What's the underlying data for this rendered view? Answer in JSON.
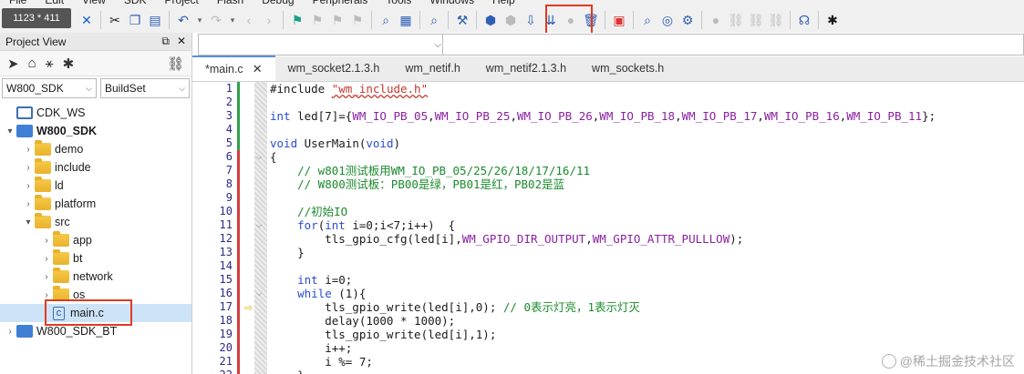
{
  "menu": [
    "File",
    "Edit",
    "View",
    "SDK",
    "Project",
    "Flash",
    "Debug",
    "Peripherals",
    "Tools",
    "Windows",
    "Help"
  ],
  "dim_badge": "1123 * 411",
  "toolbar_icons": [
    "new-icon",
    "open-icon",
    "save-icon",
    "close-icon",
    "cut-icon",
    "copy-icon",
    "paste-icon",
    "undo-icon",
    "redo-icon",
    "back-icon",
    "forward-icon",
    "bookmark-icon",
    "bookmark-prev-icon",
    "bookmark-next-icon",
    "bookmark-clear-icon",
    "find-icon",
    "find-in-files-icon",
    "find-replace-icon",
    "build-icon",
    "rebuild-icon",
    "download-icon",
    "erase-icon",
    "delete-icon",
    "load-icon",
    "debug-icon",
    "debug-start-icon",
    "settings-icon",
    "breakpoint-icon",
    "link-icon",
    "unlink-icon",
    "unlink2-icon",
    "help-icon",
    "bug-icon"
  ],
  "project_view": {
    "title": "Project View",
    "select_project": "W800_SDK",
    "select_config": "BuildSet",
    "tree": [
      {
        "label": "CDK_WS",
        "level": 0,
        "type": "workspace",
        "twisty": ""
      },
      {
        "label": "W800_SDK",
        "level": 0,
        "type": "project",
        "twisty": "▾",
        "bold": true
      },
      {
        "label": "demo",
        "level": 1,
        "type": "folder",
        "twisty": "›"
      },
      {
        "label": "include",
        "level": 1,
        "type": "folder",
        "twisty": "›"
      },
      {
        "label": "ld",
        "level": 1,
        "type": "folder",
        "twisty": "›"
      },
      {
        "label": "platform",
        "level": 1,
        "type": "folder",
        "twisty": "›"
      },
      {
        "label": "src",
        "level": 1,
        "type": "folder",
        "twisty": "▾"
      },
      {
        "label": "app",
        "level": 2,
        "type": "folder",
        "twisty": "›"
      },
      {
        "label": "bt",
        "level": 2,
        "type": "folder",
        "twisty": "›"
      },
      {
        "label": "network",
        "level": 2,
        "type": "folder",
        "twisty": "›"
      },
      {
        "label": "os",
        "level": 2,
        "type": "folder",
        "twisty": "›"
      },
      {
        "label": "main.c",
        "level": 2,
        "type": "cfile",
        "twisty": "",
        "selected": true
      },
      {
        "label": "W800_SDK_BT",
        "level": 0,
        "type": "project",
        "twisty": "›"
      }
    ]
  },
  "tabs": [
    {
      "label": "*main.c",
      "active": true,
      "close": "✕"
    },
    {
      "label": "wm_socket2.1.3.h",
      "active": false
    },
    {
      "label": "wm_netif.h",
      "active": false
    },
    {
      "label": "wm_netif2.1.3.h",
      "active": false
    },
    {
      "label": "wm_sockets.h",
      "active": false
    }
  ],
  "code_lines": [
    "#include \"wm_include.h\"",
    "",
    "int led[7]={WM_IO_PB_05,WM_IO_PB_25,WM_IO_PB_26,WM_IO_PB_18,WM_IO_PB_17,WM_IO_PB_16,WM_IO_PB_11};",
    "",
    "void UserMain(void)",
    "{",
    "    // w801测试板用WM_IO_PB_05/25/26/18/17/16/11",
    "    // W800测试板：PB00是绿，PB01是红，PB02是蓝",
    "",
    "    //初始IO",
    "    for(int i=0;i<7;i++)  {",
    "        tls_gpio_cfg(led[i],WM_GPIO_DIR_OUTPUT,WM_GPIO_ATTR_PULLLOW);",
    "    }",
    "",
    "    int i=0;",
    "    while (1){",
    "        tls_gpio_write(led[i],0); // 0表示灯亮，1表示灯灭",
    "        delay(1000 * 1000);",
    "        tls_gpio_write(led[i],1);",
    "        i++;",
    "        i %= 7;",
    "    }"
  ],
  "watermark": "@稀土掘金技术社区",
  "colors": {
    "accent_red": "#e03a1f",
    "keyword": "#2a4bd6",
    "macro": "#8b1fa3",
    "comment": "#1b8a2e",
    "string": "#c0392b"
  }
}
